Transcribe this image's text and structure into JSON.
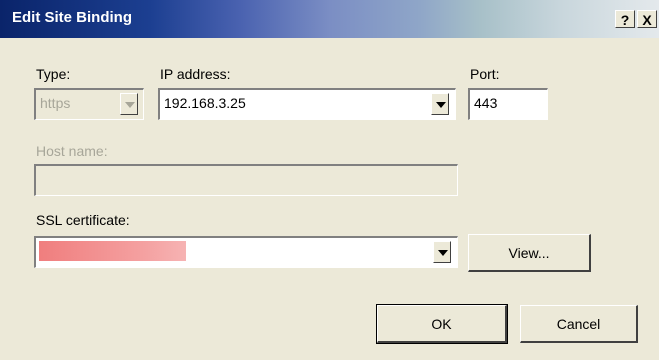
{
  "dialog": {
    "title": "Edit Site Binding",
    "help_button": "?",
    "close_button": "X"
  },
  "type": {
    "label": "Type:",
    "value": "https"
  },
  "ip_address": {
    "label": "IP address:",
    "value": "192.168.3.25"
  },
  "port": {
    "label": "Port:",
    "value": "443"
  },
  "host_name": {
    "label": "Host name:",
    "value": ""
  },
  "ssl_certificate": {
    "label": "SSL certificate:",
    "value": ""
  },
  "buttons": {
    "view": "View...",
    "ok": "OK",
    "cancel": "Cancel"
  }
}
